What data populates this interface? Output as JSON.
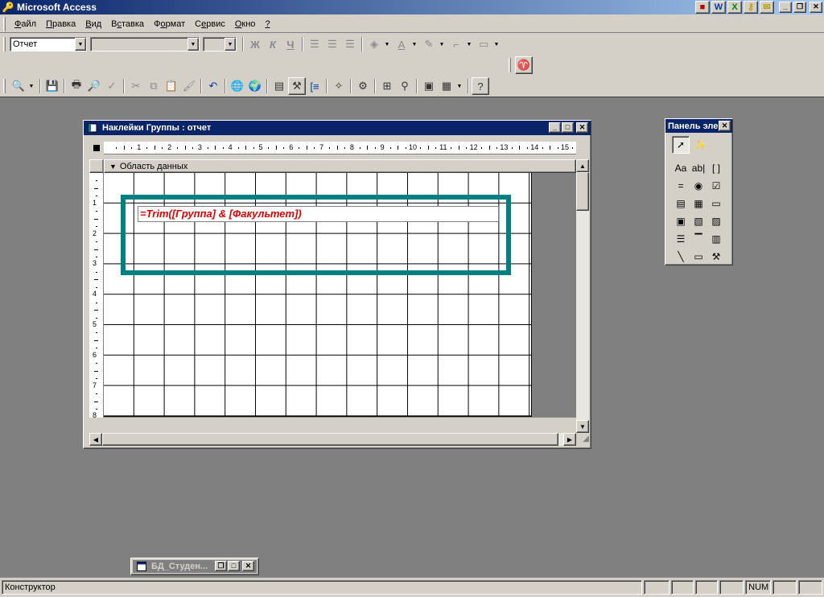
{
  "app": {
    "title": "Microsoft Access",
    "office_icons": [
      "W",
      "X"
    ]
  },
  "menu": [
    {
      "label": "Файл",
      "hotkey": "Ф",
      "rest": "айл"
    },
    {
      "label": "Правка",
      "hotkey": "П",
      "rest": "равка"
    },
    {
      "label": "Вид",
      "hotkey": "В",
      "rest": "ид"
    },
    {
      "label": "Вставка",
      "hotkey": "с",
      "pre": "В",
      "rest": "тавка"
    },
    {
      "label": "Формат",
      "hotkey": "о",
      "pre": "Ф",
      "rest": "рмат"
    },
    {
      "label": "Сервис",
      "hotkey": "е",
      "pre": "С",
      "rest": "рвис"
    },
    {
      "label": "Окно",
      "hotkey": "О",
      "rest": "кно"
    },
    {
      "label": "?",
      "hotkey": "?",
      "rest": ""
    }
  ],
  "format_toolbar": {
    "object_combo": "Отчет",
    "font_combo": "",
    "size_combo": "",
    "bold": "Ж",
    "italic": "К",
    "underline": "Ч"
  },
  "report_window": {
    "title": "Наклейки Группы : отчет",
    "section_label": "Область данных",
    "textbox_expression": "=Trim([Группа] & [Факультет])",
    "ruler_numbers": [
      "1",
      "2",
      "3",
      "4",
      "5",
      "6",
      "7",
      "8",
      "9",
      "10",
      "11",
      "12",
      "13",
      "14",
      "15"
    ],
    "vruler_numbers": [
      "1",
      "2",
      "3",
      "4",
      "5",
      "6",
      "7",
      "8"
    ]
  },
  "toolbox": {
    "title": "Панель эле",
    "tools": [
      {
        "name": "label-tool-icon",
        "glyph": "Aa"
      },
      {
        "name": "textbox-tool-icon",
        "glyph": "ab|"
      },
      {
        "name": "option-group-tool-icon",
        "glyph": "[ ]"
      },
      {
        "name": "toggle-button-tool-icon",
        "glyph": "="
      },
      {
        "name": "option-button-tool-icon",
        "glyph": "◉"
      },
      {
        "name": "checkbox-tool-icon",
        "glyph": "☑"
      },
      {
        "name": "combobox-tool-icon",
        "glyph": "▤"
      },
      {
        "name": "listbox-tool-icon",
        "glyph": "▦"
      },
      {
        "name": "command-button-tool-icon",
        "glyph": "▭"
      },
      {
        "name": "image-tool-icon",
        "glyph": "▣"
      },
      {
        "name": "unbound-object-tool-icon",
        "glyph": "▧"
      },
      {
        "name": "bound-object-tool-icon",
        "glyph": "▨"
      },
      {
        "name": "page-break-tool-icon",
        "glyph": "☰"
      },
      {
        "name": "tab-control-tool-icon",
        "glyph": "▔"
      },
      {
        "name": "subreport-tool-icon",
        "glyph": "▥"
      },
      {
        "name": "line-tool-icon",
        "glyph": "╲"
      },
      {
        "name": "rectangle-tool-icon",
        "glyph": "▭"
      },
      {
        "name": "more-controls-tool-icon",
        "glyph": "⚒"
      }
    ]
  },
  "minimized_window": {
    "title": "БД_Студен..."
  },
  "status": {
    "mode": "Конструктор",
    "num": "NUM"
  },
  "colors": {
    "titlebar": "#0a246a",
    "highlight": "#008080",
    "expression": "#e00000",
    "workspace": "#808080"
  }
}
